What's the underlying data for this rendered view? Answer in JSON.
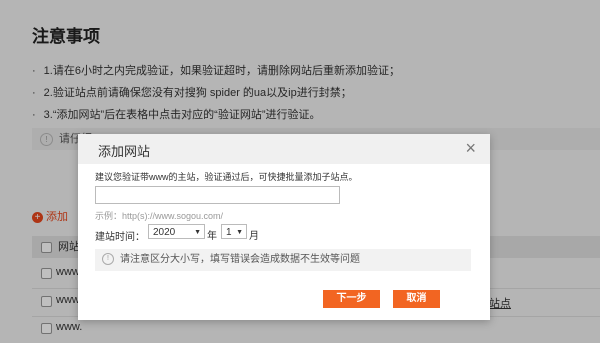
{
  "background": {
    "title": "注意事项",
    "notes": [
      "1.请在6小时之内完成验证，如果验证超时，请删除网站后重新添加验证；",
      "2.验证站点前请确保您没有对搜狗 spider 的ua以及ip进行封禁；",
      "3.“添加网站”后在表格中点击对应的“验证网站”进行验证。"
    ],
    "warn_prefix": "请仔细",
    "add_button_label": "添加",
    "table_header_label": "网站",
    "row_label": "www.",
    "right_link_label": "站点",
    "note_bullet": "·"
  },
  "modal": {
    "title": "添加网站",
    "close_symbol": "×",
    "hint": "建议您验证带www的主站，验证通过后，可快捷批量添加子站点。",
    "url_input_value": "",
    "example": "示例：http(s)://www.sogou.com/",
    "date_label": "建站时间：",
    "year_value": "2020",
    "year_unit": "年",
    "month_value": "1",
    "month_unit": "月",
    "notice": "请注意区分大小写，填写错误会造成数据不生效等问题",
    "next_button": "下一步",
    "cancel_button": "取消"
  },
  "colors": {
    "accent": "#f26522",
    "overlay": "rgba(0,0,0,0.25)"
  }
}
